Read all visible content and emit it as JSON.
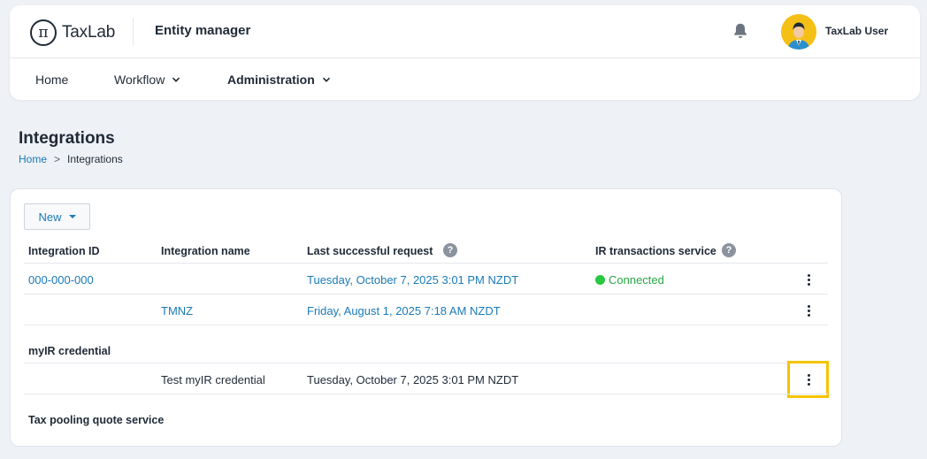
{
  "header": {
    "logo_symbol": "π",
    "logo_text": "TaxLab",
    "app_title": "Entity manager",
    "username": "TaxLab User"
  },
  "nav": {
    "home": "Home",
    "workflow": "Workflow",
    "administration": "Administration"
  },
  "page": {
    "title": "Integrations",
    "breadcrumb_home": "Home",
    "breadcrumb_sep": ">",
    "breadcrumb_current": "Integrations"
  },
  "toolbar": {
    "new_label": "New"
  },
  "table": {
    "columns": [
      "Integration ID",
      "Integration name",
      "Last successful request",
      "IR transactions service"
    ],
    "help_glyph": "?",
    "rows": [
      {
        "id": "000-000-000",
        "name": "",
        "last": "Tuesday, October 7, 2025 3:01 PM NZDT",
        "status": "Connected"
      },
      {
        "id": "",
        "name": "TMNZ",
        "last": "Friday, August 1, 2025 7:18 AM NZDT",
        "status": ""
      }
    ],
    "section_myir": "myIR credential",
    "myir_rows": [
      {
        "name": "Test myIR credential",
        "last": "Tuesday, October 7, 2025 3:01 PM NZDT"
      }
    ],
    "section_taxpool": "Tax pooling quote service"
  },
  "colors": {
    "accent": "#1a7ab8",
    "connected": "#28c840",
    "highlight": "#f5c400"
  }
}
